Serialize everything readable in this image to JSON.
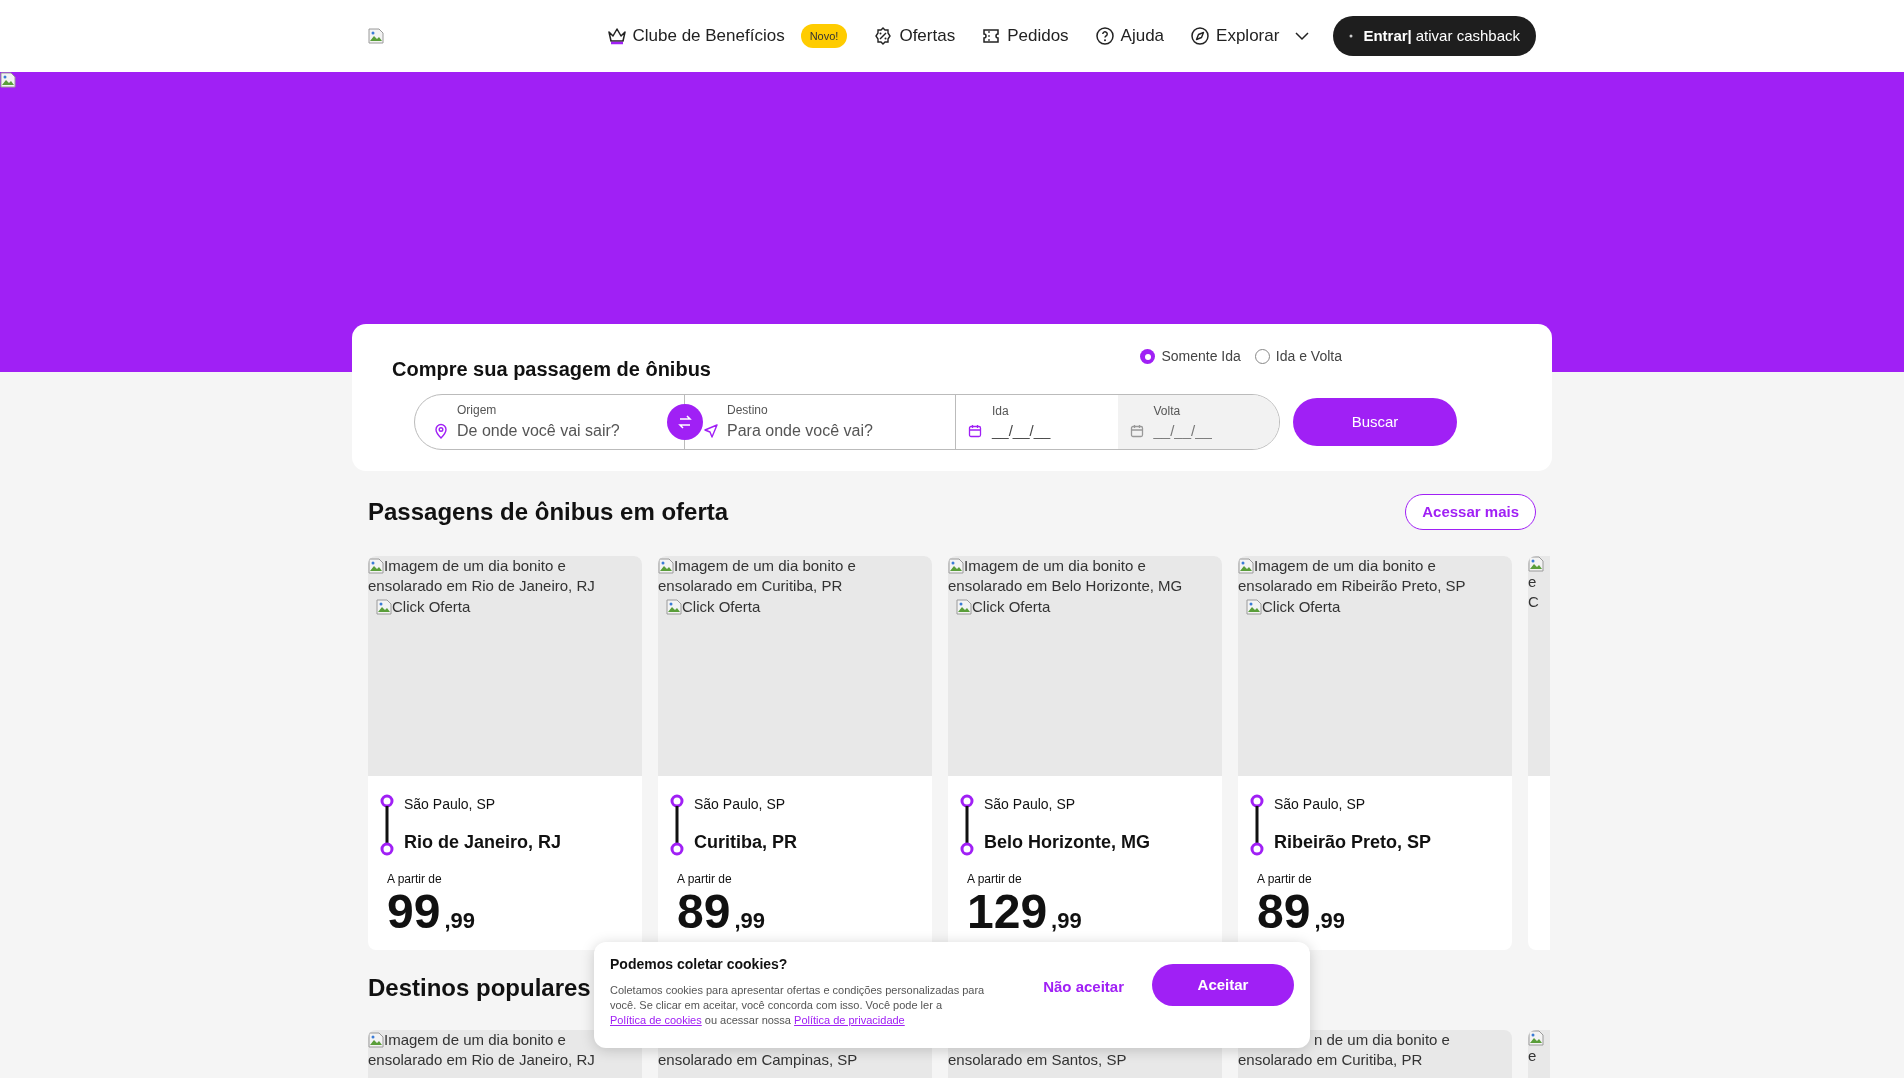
{
  "header": {
    "nav": [
      {
        "kind": "crown",
        "label": "Clube de Benefícios",
        "badge": "Novo!"
      },
      {
        "kind": "percent",
        "label": "Ofertas"
      },
      {
        "kind": "ticket",
        "label": "Pedidos"
      },
      {
        "kind": "help",
        "label": "Ajuda"
      },
      {
        "kind": "compass",
        "label": "Explorar",
        "dropdown": true
      }
    ],
    "login": {
      "strong": "Entrar|",
      "label": "ativar cashback"
    }
  },
  "search": {
    "title": "Compre sua passagem de ônibus",
    "trip_types": [
      {
        "label": "Somente Ida",
        "selected": true
      },
      {
        "label": "Ida e Volta",
        "selected": false
      }
    ],
    "origin": {
      "label": "Origem",
      "placeholder": "De onde você vai sair?"
    },
    "destination": {
      "label": "Destino",
      "placeholder": "Para onde você vai?"
    },
    "dates": [
      {
        "label": "Ida",
        "placeholder": "__/__/__",
        "disabled": false
      },
      {
        "label": "Volta",
        "placeholder": "__/__/__",
        "disabled": true
      }
    ],
    "button": "Buscar"
  },
  "offers": {
    "title": "Passagens de ônibus em oferta",
    "more": "Acessar mais",
    "cards": [
      {
        "alt": [
          "Imagem de um dia bonito e",
          "ensolarado em Rio de Janeiro, RJ"
        ],
        "badge_alt": "Click Oferta",
        "from": "São Paulo, SP",
        "to": "Rio de Janeiro, RJ",
        "price_label": "A partir de",
        "price": "99",
        "cents": ",99"
      },
      {
        "alt": [
          "Imagem de um dia bonito e",
          "ensolarado em Curitiba, PR"
        ],
        "badge_alt": "Click Oferta",
        "from": "São Paulo, SP",
        "to": "Curitiba, PR",
        "price_label": "A partir de",
        "price": "89",
        "cents": ",99"
      },
      {
        "alt": [
          "Imagem de um dia bonito e",
          "ensolarado em Belo Horizonte, MG"
        ],
        "badge_alt": "Click Oferta",
        "from": "São Paulo, SP",
        "to": "Belo Horizonte, MG",
        "price_label": "A partir de",
        "price": "129",
        "cents": ",99"
      },
      {
        "alt": [
          "Imagem de um dia bonito e",
          "ensolarado em Ribeirão Preto, SP"
        ],
        "badge_alt": "Click Oferta",
        "from": "São Paulo, SP",
        "to": "Ribeirão Preto, SP",
        "price_label": "A partir de",
        "price": "89",
        "cents": ",99"
      }
    ],
    "partial_card": {
      "alt": [
        "e",
        "C"
      ]
    }
  },
  "popular": {
    "title": "Destinos populares",
    "cards": [
      {
        "alt": [
          "Imagem de um dia bonito e",
          "ensolarado em Rio de Janeiro, RJ"
        ]
      },
      {
        "alt": [
          "ensolarado em Campinas, SP"
        ]
      },
      {
        "alt": [
          "ensolarado em Santos, SP"
        ]
      },
      {
        "alt": [
          "n de um dia bonito e",
          "ensolarado em Curitiba, PR"
        ]
      }
    ],
    "partial_card": {
      "alt": [
        "e"
      ]
    }
  },
  "cookies": {
    "title": "Podemos coletar cookies?",
    "text": "Coletamos cookies para apresentar ofertas e condições personalizadas para você. Se clicar em aceitar, você concorda com isso. Você pode ler a",
    "link1": "Política de cookies",
    "middle": "ou acessar nossa",
    "link2": "Política de privacidade",
    "decline": "Não aceitar",
    "accept": "Aceitar"
  }
}
